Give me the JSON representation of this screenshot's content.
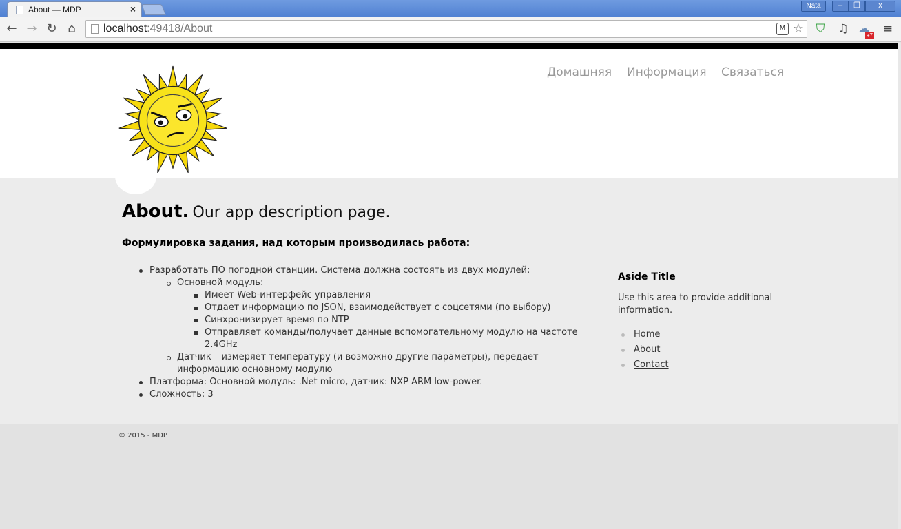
{
  "browser": {
    "tab_title": "About — MDP",
    "tab_close": "×",
    "user_name": "Nata",
    "window_buttons": {
      "minimize": "–",
      "maximize": "❐",
      "close": "x"
    },
    "url_host": "localhost",
    "url_rest": ":49418/About",
    "extension_badge": "+7"
  },
  "nav": {
    "home": "Домашняя",
    "info": "Информация",
    "contact": "Связаться"
  },
  "main": {
    "title_bold": "About.",
    "title_rest": "Our app description page.",
    "task_heading": "Формулировка задания, над которым производилась работа:",
    "items": [
      "Разработать ПО погодной станции. Система должна состоять из двух модулей:",
      "Основной модуль:",
      "Имеет Web-интерфейс управления",
      "Отдает информацию по JSON, взаимодействует с соцсетями (по выбору)",
      "Синхронизирует время по NTP",
      "Отправляет команды/получает данные вспомогательному модулю на частоте 2.4GHz",
      "Датчик – измеряет температуру (и возможно другие параметры), передает информацию основному модулю",
      "Платформа: Основной модуль: .Net micro, датчик: NXP ARM low-power.",
      "Сложность: 3"
    ]
  },
  "aside": {
    "title": "Aside Title",
    "text": "Use this area to provide additional information.",
    "links": [
      "Home",
      "About",
      "Contact"
    ]
  },
  "footer": {
    "text": "© 2015 - MDP"
  }
}
